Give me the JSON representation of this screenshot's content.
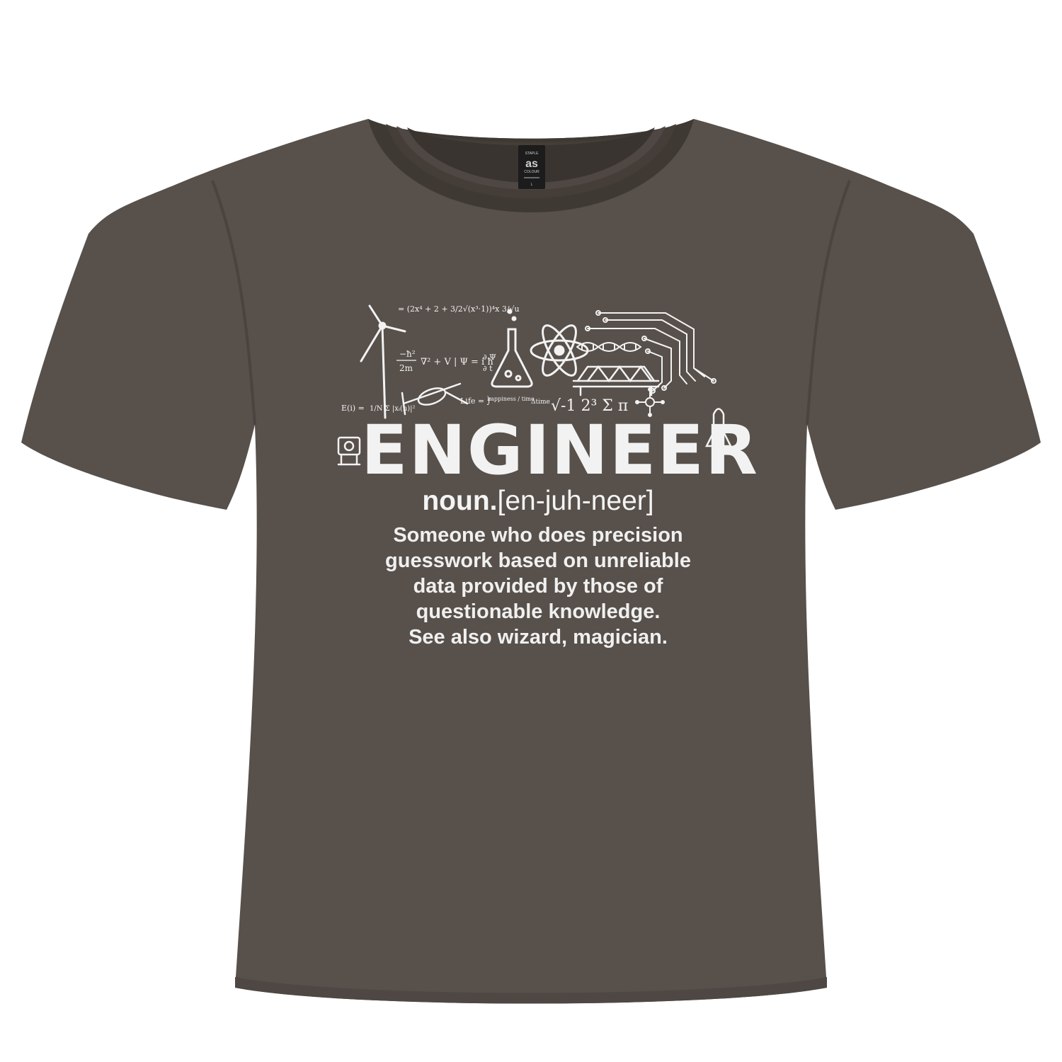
{
  "colors": {
    "shirt": "#57504b",
    "shirt_shadow": "#3f3934",
    "print": "#f2f2f2",
    "neck_tag": "#1c1c1c",
    "background": "#ffffff"
  },
  "neck_tag": {
    "brand_line1": "STAPLE",
    "brand_logo": "as",
    "brand_line2": "COLOUR",
    "size": "L"
  },
  "print": {
    "illustrations": [
      "wind-turbine-icon",
      "flask-icon",
      "atom-icon",
      "dna-icon",
      "bridge-icon",
      "circuit-icon",
      "helicopter-icon",
      "rocket-icon",
      "robot-icon"
    ],
    "equations": {
      "schrodinger_lhs": "−ħ²",
      "schrodinger_den": "2m",
      "schrodinger_rhs": "∇² + V | Ψ = i ħ",
      "partial": "∂ Ψ",
      "partial_den": "∂ t",
      "energy": "E(i) = ",
      "energy_sum": "1/N Σ |xᵢ(n)|²",
      "life": "Life = ∫",
      "life_frac": "happiness / time",
      "life_tail": "Δtime",
      "top_formula": "= (2x⁴ + 2 + 3/2√(x³·1))⁴x 3/√u",
      "math_symbols": "√-1  2³  Σ  π"
    },
    "title": "ENGINEER",
    "part_of_speech": "noun.",
    "pronunciation": "[en-juh-neer]",
    "definition_lines": [
      "Someone who does precision",
      "guesswork based on unreliable",
      "data provided by those of",
      "questionable knowledge.",
      "See also wizard, magician."
    ]
  }
}
